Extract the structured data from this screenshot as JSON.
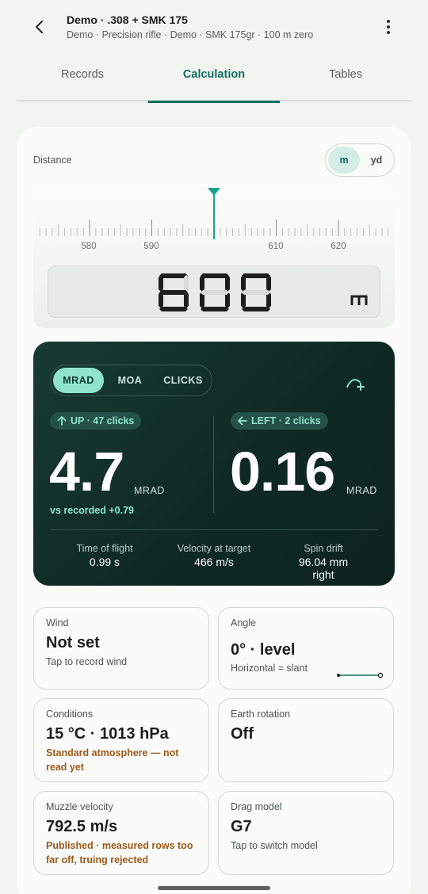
{
  "header": {
    "title": "Demo · .308 + SMK 175",
    "subtitle": "Demo · Precision rifle · Demo · SMK 175gr · 100 m zero"
  },
  "tabs": [
    "Records",
    "Calculation",
    "Tables"
  ],
  "active_tab": "Calculation",
  "distance": {
    "label": "Distance",
    "units": [
      "m",
      "yd"
    ],
    "selected_unit": "m",
    "ruler_labels": [
      "580",
      "590",
      "610",
      "620"
    ],
    "value": "600",
    "value_unit": "m"
  },
  "solution": {
    "modes": [
      "MRAD",
      "MOA",
      "CLICKS"
    ],
    "active_mode": "MRAD",
    "elevation": {
      "chip": "UP · 47 clicks",
      "value": "4.7",
      "unit": "MRAD",
      "note": "vs recorded +0.79"
    },
    "windage": {
      "chip": "LEFT · 2 clicks",
      "value": "0.16",
      "unit": "MRAD"
    },
    "stats": [
      {
        "label": "Time of flight",
        "value": "0.99 s"
      },
      {
        "label": "Velocity at target",
        "value": "466 m/s"
      },
      {
        "label": "Spin drift",
        "value": "96.04 mm right"
      }
    ]
  },
  "cards": {
    "wind": {
      "label": "Wind",
      "value": "Not set",
      "sub": "Tap to record wind"
    },
    "angle": {
      "label": "Angle",
      "value": "0° · level",
      "sub": "Horizontal = slant"
    },
    "conditions": {
      "label": "Conditions",
      "value": "15 °C · 1013 hPa",
      "sub": "Standard atmosphere — not read yet"
    },
    "earth": {
      "label": "Earth rotation",
      "value": "Off"
    },
    "muzzle": {
      "label": "Muzzle velocity",
      "value": "792.5 m/s",
      "sub": "Published · measured rows too far off, truing rejected"
    },
    "drag": {
      "label": "Drag model",
      "value": "G7",
      "sub": "Tap to switch model"
    }
  },
  "colors": {
    "accent": "#0f6e5b",
    "panel": "#143a31",
    "mint": "#8fe5cc",
    "warning": "#9a5a1a"
  },
  "icons": [
    "back-arrow-icon",
    "more-vert-icon",
    "trajectory-icon",
    "arrow-up-icon",
    "arrow-left-icon"
  ]
}
